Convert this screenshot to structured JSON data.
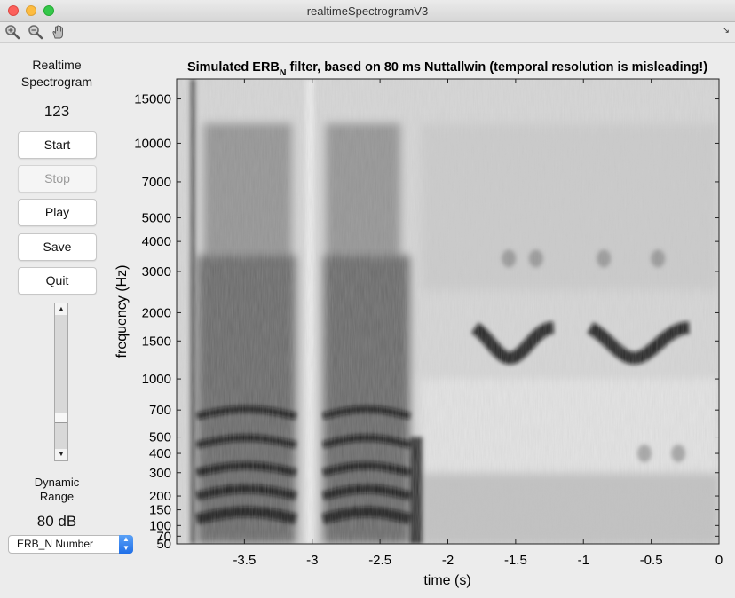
{
  "window": {
    "title": "realtimeSpectrogramV3"
  },
  "toolbar": {
    "tools": [
      "zoom-in-icon",
      "zoom-out-icon",
      "pan-hand-icon"
    ],
    "corner_glyph": "↘"
  },
  "sidebar": {
    "title_line1": "Realtime",
    "title_line2": "Spectrogram",
    "counter": "123",
    "buttons": {
      "start": "Start",
      "stop": "Stop",
      "play": "Play",
      "save": "Save",
      "quit": "Quit"
    },
    "slider_value": 0.78,
    "dynamic_range_line1": "Dynamic",
    "dynamic_range_line2": "Range",
    "dynamic_range_value": "80 dB",
    "scale_select": "ERB_N Number"
  },
  "chart_data": {
    "type": "heatmap",
    "title_prefix": "Simulated ERB",
    "title_sub": "N",
    "title_suffix": " filter, based on 80 ms Nuttallwin (temporal resolution is misleading!)",
    "xlabel": "time (s)",
    "ylabel": "frequency (Hz)",
    "xlim": [
      -4,
      0
    ],
    "x_ticks": [
      -3.5,
      -3,
      -2.5,
      -2,
      -1.5,
      -1,
      -0.5,
      0
    ],
    "x_tick_labels": [
      "-3.5",
      "-3",
      "-2.5",
      "-2",
      "-1.5",
      "-1",
      "-0.5",
      "0"
    ],
    "y_scale": "erb",
    "ylim": [
      50,
      18000
    ],
    "y_ticks": [
      15000,
      10000,
      7000,
      5000,
      4000,
      3000,
      2000,
      1500,
      1000,
      700,
      500,
      400,
      300,
      200,
      150,
      100,
      70,
      50
    ],
    "y_tick_labels": [
      "15000",
      "10000",
      "7000",
      "5000",
      "4000",
      "3000",
      "2000",
      "1500",
      "1000",
      "700",
      "500",
      "400",
      "300",
      "200",
      "150",
      "100",
      "70",
      "50"
    ],
    "colormap": "gray_reversed",
    "bg_color": "#d8d8d8",
    "dark_color": "#0c0c0c"
  }
}
